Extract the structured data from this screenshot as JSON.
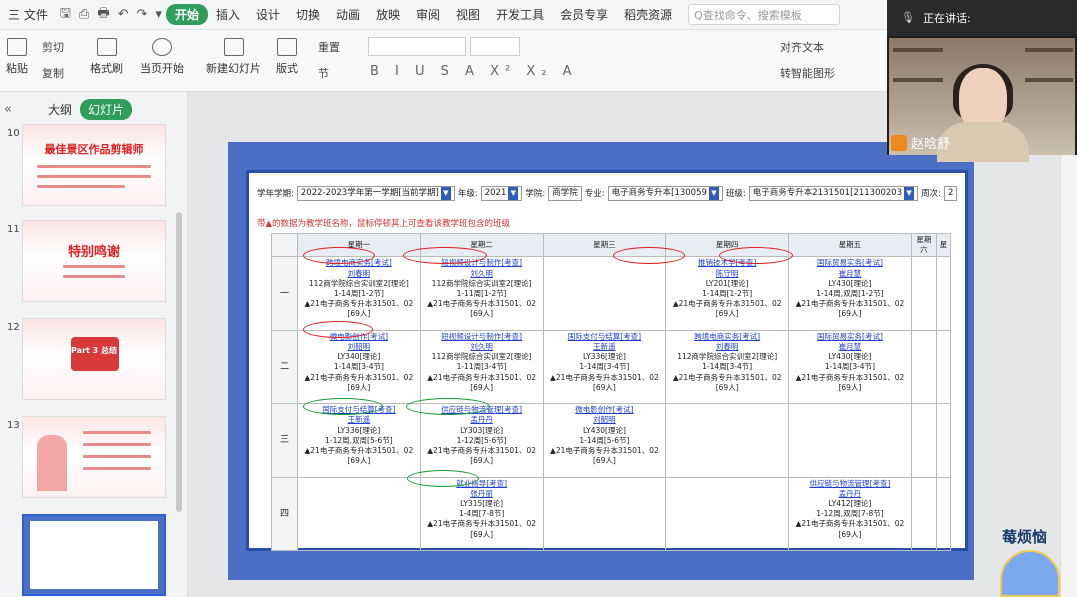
{
  "menubar": {
    "file_label": "三 文件",
    "items": [
      "插入",
      "设计",
      "切换",
      "动画",
      "放映",
      "审阅",
      "视图",
      "开发工具",
      "会员专享",
      "稻壳资源"
    ],
    "active_tab": "开始",
    "search_placeholder": "Q查找命令、搜索模板"
  },
  "ribbon": {
    "paste": "粘贴",
    "cut": "剪切",
    "copy": "复制",
    "format_painter": "格式刷",
    "from_current": "当页开始",
    "new_slide": "新建幻灯片",
    "layout": "版式",
    "section": "节",
    "reset": "重置",
    "align_text": "对齐文本",
    "convert_smartart": "转智能图形"
  },
  "leftpane": {
    "tab_outline": "大纲",
    "tab_slides": "幻灯片",
    "slides": [
      {
        "num": "10",
        "title": "最佳景区作品剪辑师"
      },
      {
        "num": "11",
        "title": "特别鸣谢"
      },
      {
        "num": "12",
        "title": "Part 3 总结"
      },
      {
        "num": "13",
        "title": ""
      }
    ]
  },
  "video": {
    "speaking_label": "正在讲话:",
    "name": "赵晗舒"
  },
  "badge_text": "莓烦恼",
  "schedule": {
    "term_label": "学年学期:",
    "term_value": "2022-2023学年第一学期[当前学期]",
    "grade_label": "年级:",
    "grade_value": "2021",
    "college_label": "学院:",
    "college_value": "商学院",
    "major_label": "专业:",
    "major_value": "电子商务专升本[130059",
    "class_label": "班级:",
    "class_value": "电子商务专升本2131501[211300203",
    "week_label": "周次:",
    "week_value": "2",
    "note": "带▲的数据为教学班名称，鼠标停顿其上可查看该教学班包含的班级",
    "days": [
      "星期一",
      "星期二",
      "星期三",
      "星期四",
      "星期五",
      "星期六",
      "星"
    ],
    "rows": [
      {
        "label": "一",
        "cells": [
          {
            "course": "跨境电商实务[考试]",
            "teacher": "刘春明",
            "room": "112商学院综合实训室2[理论]",
            "weeks": "1-14周[1-2节]",
            "cls": "▲21电子商务专升本31501、02 [69人]"
          },
          {
            "course": "短视频设计与制作[考查]",
            "teacher": "刘久明",
            "room": "112商学院综合实训室2[理论]",
            "weeks": "1-11周[1-2节]",
            "cls": "▲21电子商务专升本31501、02 [69人]"
          },
          null,
          {
            "course": "推销技术学[考查]",
            "teacher": "陈守明",
            "room": "LY201[理论]",
            "weeks": "1-14周[1-2节]",
            "cls": "▲21电子商务专升本31501、02 [69人]"
          },
          {
            "course": "国际贸易实务[考试]",
            "teacher": "崔月慧",
            "room": "LY430[理论]",
            "weeks": "1-14周,双周[1-2节]",
            "cls": "▲21电子商务专升本31501、02 [69人]"
          },
          null
        ]
      },
      {
        "label": "二",
        "cells": [
          {
            "course": "微电影创作[考试]",
            "teacher": "刘韶明",
            "room": "LY340[理论]",
            "weeks": "1-14周[3-4节]",
            "cls": "▲21电子商务专升本31501、02 [69人]"
          },
          {
            "course": "短视频设计与制作[考查]",
            "teacher": "刘久明",
            "room": "112商学院综合实训室2[理论]",
            "weeks": "1-11周[3-4节]",
            "cls": "▲21电子商务专升本31501、02 [69人]"
          },
          {
            "course": "国际支付与结算[考查]",
            "teacher": "王新遥",
            "room": "LY336[理论]",
            "weeks": "1-14周[3-4节]",
            "cls": "▲21电子商务专升本31501、02 [69人]"
          },
          {
            "course": "跨境电商实务[考试]",
            "teacher": "刘春明",
            "room": "112商学院综合实训室2[理论]",
            "weeks": "1-14周[3-4节]",
            "cls": "▲21电子商务专升本31501、02 [69人]"
          },
          {
            "course": "国际贸易实务[考试]",
            "teacher": "崔月慧",
            "room": "LY430[理论]",
            "weeks": "1-14周[3-4节]",
            "cls": "▲21电子商务专升本31501、02 [69人]"
          },
          null
        ]
      },
      {
        "label": "三",
        "cells": [
          {
            "course": "国际支付与结算[考查]",
            "teacher": "王新遥",
            "room": "LY336[理论]",
            "weeks": "1-12周,双周[5-6节]",
            "cls": "▲21电子商务专升本31501、02 [69人]"
          },
          {
            "course": "供应链与物流管理[考查]",
            "teacher": "孟丹丹",
            "room": "LY303[理论]",
            "weeks": "1-12周[5-6节]",
            "cls": "▲21电子商务专升本31501、02 [69人]"
          },
          {
            "course": "微电影创作[考试]",
            "teacher": "刘韶明",
            "room": "LY430[理论]",
            "weeks": "1-14周[5-6节]",
            "cls": "▲21电子商务专升本31501、02 [69人]"
          },
          null,
          null,
          null
        ]
      },
      {
        "label": "四",
        "cells": [
          null,
          {
            "course": "就业指导[考查]",
            "teacher": "张丹丽",
            "room": "LY315[理论]",
            "weeks": "1-4周[7-8节]",
            "cls": "▲21电子商务专升本31501、02 [69人]"
          },
          null,
          null,
          {
            "course": "供应链与物流管理[考查]",
            "teacher": "孟丹丹",
            "room": "LY412[理论]",
            "weeks": "1-12周,双周[7-8节]",
            "cls": "▲21电子商务专升本31501、02 [69人]"
          },
          null
        ]
      }
    ]
  }
}
